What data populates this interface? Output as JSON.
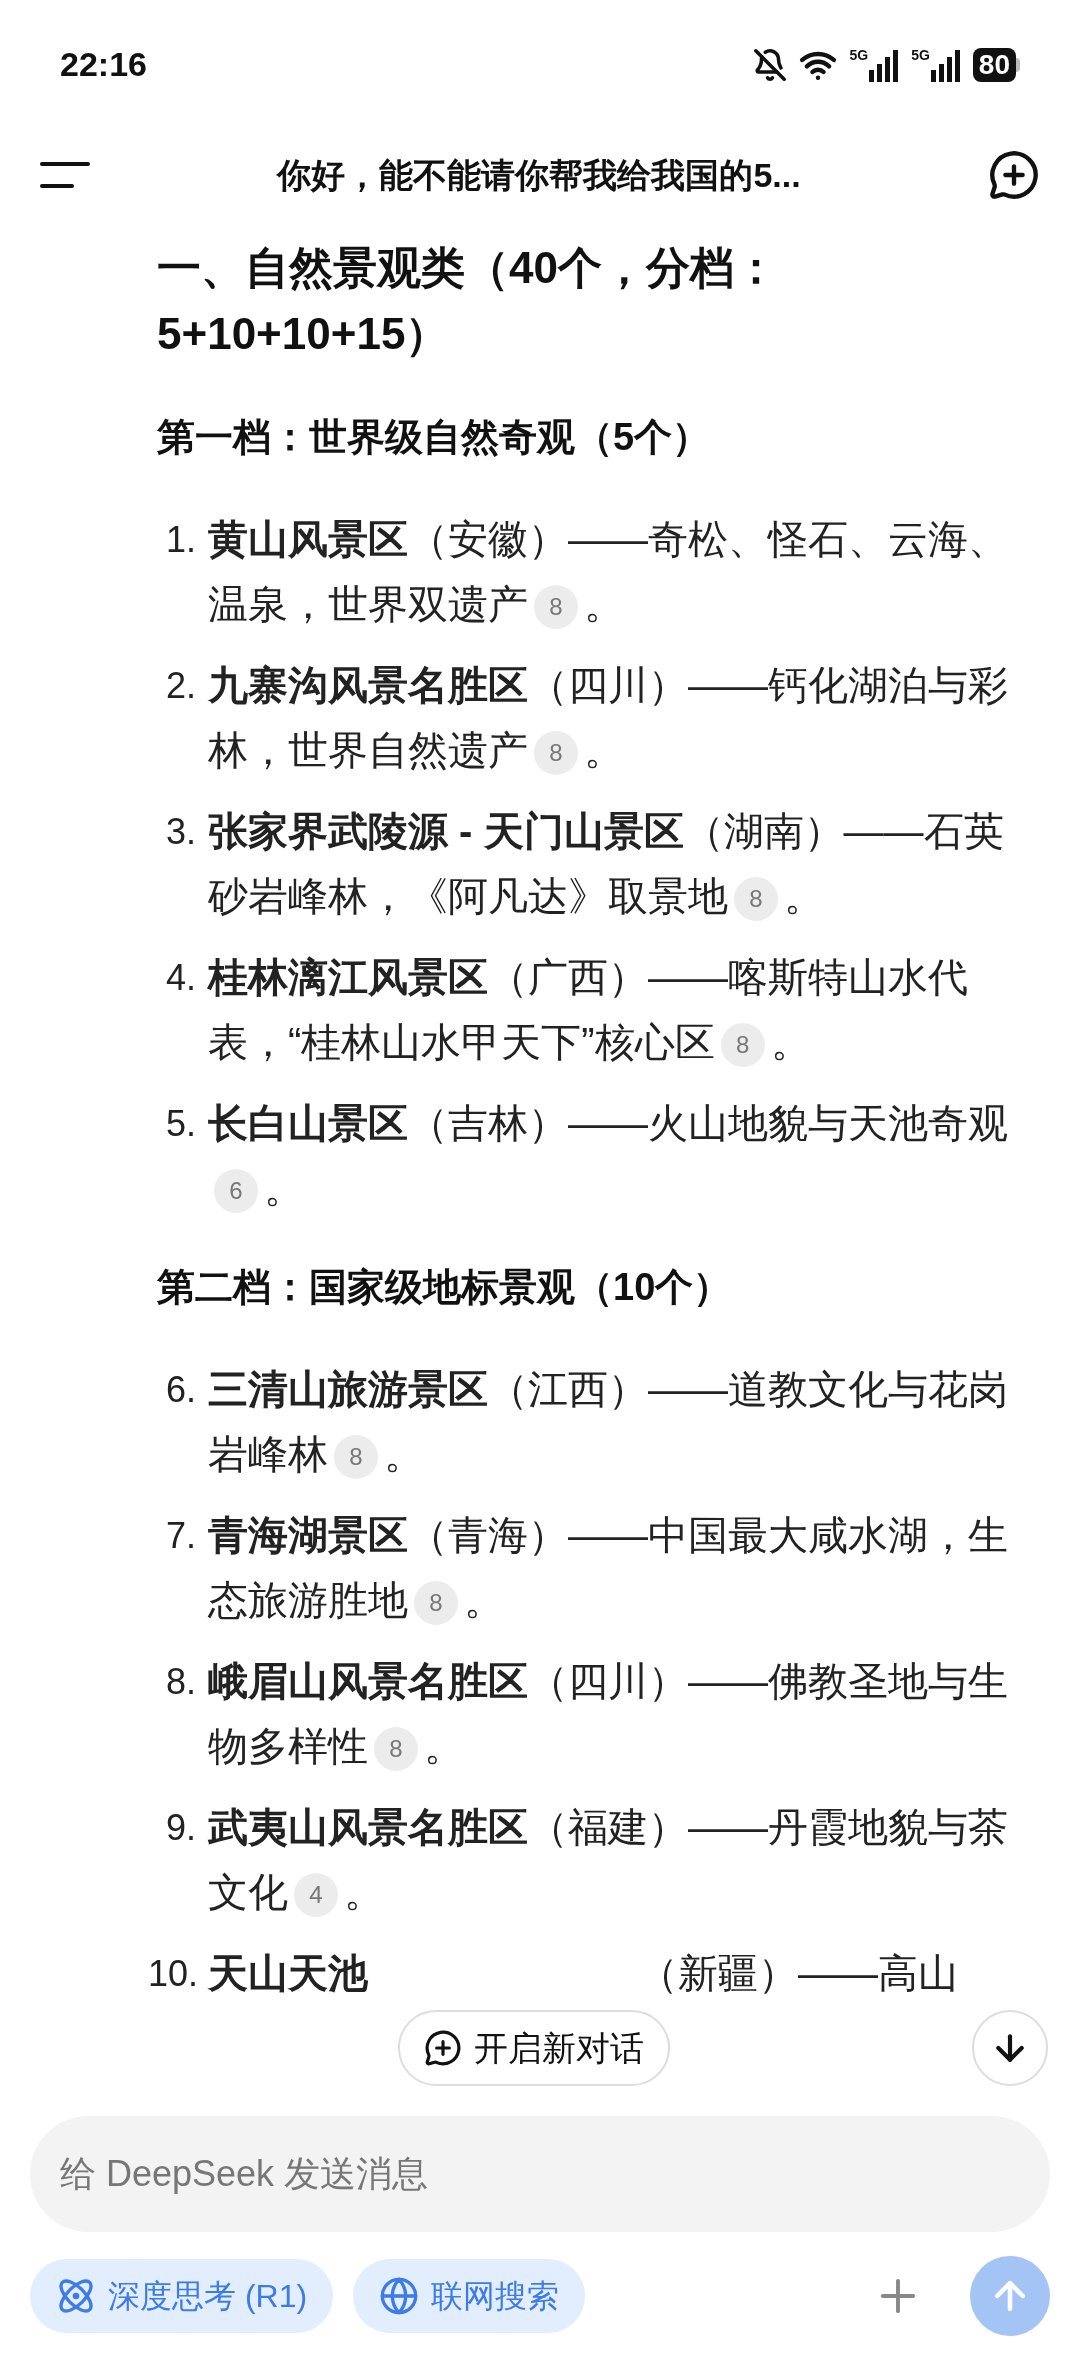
{
  "status_bar": {
    "time": "22:16",
    "battery": "80",
    "network_1": "5G",
    "network_2": "5G"
  },
  "header": {
    "title": "你好，能不能请你帮我给我国的5..."
  },
  "content": {
    "heading": "一、自然景观类（40个，分档：5+10+10+15）",
    "sections": [
      {
        "title": "第一档：世界级自然奇观（5个）",
        "items": [
          {
            "kind": "full",
            "number": "1.",
            "name": "黄山风景区",
            "region": "（安徽）",
            "description": "——奇松、怪石、云海、温泉，世界双遗产",
            "citation": "8",
            "end": "。"
          },
          {
            "kind": "full",
            "number": "2.",
            "name": "九寨沟风景名胜区",
            "region": "（四川）",
            "description": "——钙化湖泊与彩林，世界自然遗产",
            "citation": "8",
            "end": "。"
          },
          {
            "kind": "full",
            "number": "3.",
            "name": "张家界武陵源 - 天门山景区",
            "region": "（湖南）",
            "description": "——石英砂岩峰林，《阿凡达》取景地",
            "citation": "8",
            "end": "。"
          },
          {
            "kind": "full",
            "number": "4.",
            "name": "桂林漓江风景区",
            "region": "（广西）",
            "description": "——喀斯特山水代表，“桂林山水甲天下”核心区",
            "citation": "8",
            "end": "。"
          },
          {
            "kind": "full",
            "number": "5.",
            "name": "长白山景区",
            "region": "（吉林）",
            "description": "——火山地貌与天池奇观",
            "citation": "6",
            "end": "。"
          }
        ]
      },
      {
        "title": "第二档：国家级地标景观（10个）",
        "items": [
          {
            "kind": "full",
            "number": "6.",
            "name": "三清山旅游景区",
            "region": "（江西）",
            "description": "——道教文化与花岗岩峰林",
            "citation": "8",
            "end": "。"
          },
          {
            "kind": "full",
            "number": "7.",
            "name": "青海湖景区",
            "region": "（青海）",
            "description": "——中国最大咸水湖，生态旅游胜地",
            "citation": "8",
            "end": "。"
          },
          {
            "kind": "full",
            "number": "8.",
            "name": "峨眉山风景名胜区",
            "region": "（四川）",
            "description": "——佛教圣地与生物多样性",
            "citation": "8",
            "end": "。"
          },
          {
            "kind": "full",
            "number": "9.",
            "name": "武夷山风景名胜区",
            "region": "（福建）",
            "description": "——丹霞地貌与茶文化",
            "citation": "4",
            "end": "。"
          },
          {
            "kind": "clipped",
            "number": "10.",
            "name": "天山天池",
            "region": "（新疆）",
            "description": "——高山"
          }
        ]
      }
    ]
  },
  "new_chat_button": {
    "label": "开启新对话"
  },
  "composer": {
    "placeholder": "给 DeepSeek 发送消息",
    "buttons": [
      {
        "label": "深度思考 (R1)",
        "kind": "deep-think"
      },
      {
        "label": "联网搜索",
        "kind": "web-search"
      }
    ]
  }
}
